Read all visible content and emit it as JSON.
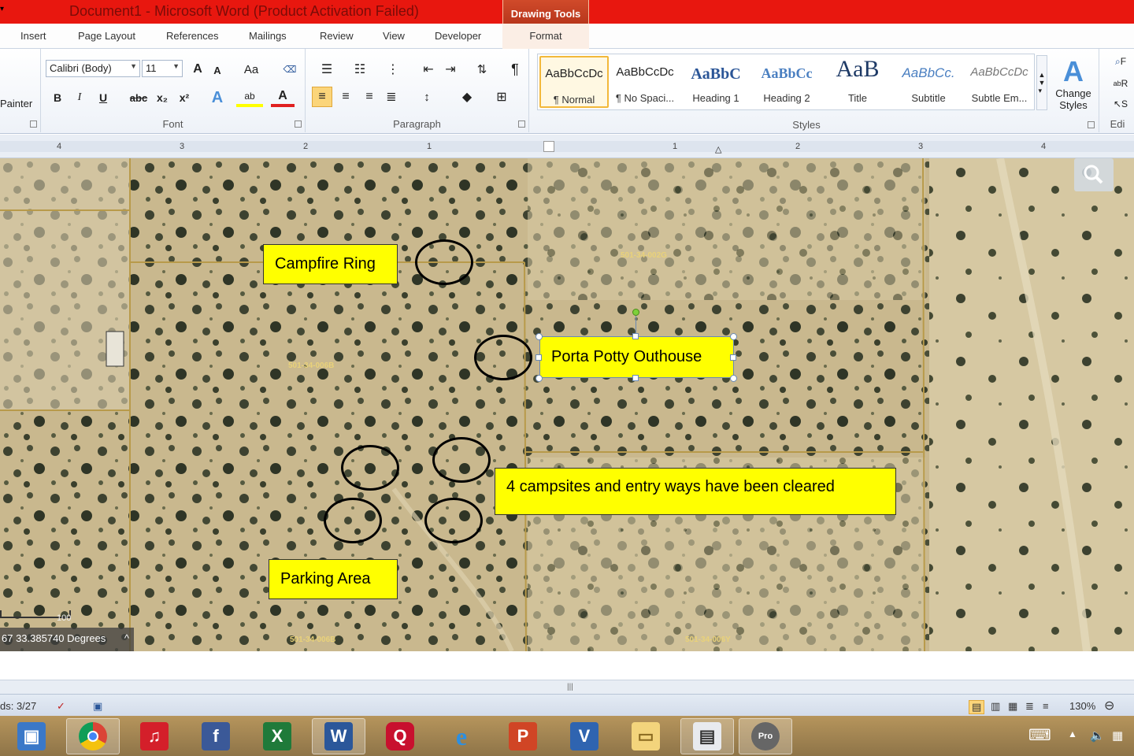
{
  "window": {
    "title": "Document1  -  Microsoft Word (Product Activation Failed)",
    "context_tab_group": "Drawing Tools"
  },
  "tabs": [
    "Insert",
    "Page Layout",
    "References",
    "Mailings",
    "Review",
    "View",
    "Developer",
    "Format"
  ],
  "ribbon": {
    "clipboard": {
      "painter_label": "Painter"
    },
    "font": {
      "label": "Font",
      "font_name": "Calibri (Body)",
      "font_size": "11",
      "grow": "A",
      "shrink": "A",
      "change_case": "Aa",
      "bold": "B",
      "italic": "I",
      "underline": "U",
      "strike": "abc",
      "subscript": "x₂",
      "superscript": "x²",
      "highlight": "ab",
      "font_color": "A"
    },
    "paragraph": {
      "label": "Paragraph",
      "pilcrow": "¶"
    },
    "styles": {
      "label": "Styles",
      "items": [
        {
          "sample": "AaBbCcDc",
          "name": "¶ Normal"
        },
        {
          "sample": "AaBbCcDc",
          "name": "¶ No Spaci..."
        },
        {
          "sample": "AaBbC",
          "name": "Heading 1"
        },
        {
          "sample": "AaBbCc",
          "name": "Heading 2"
        },
        {
          "sample": "AaB",
          "name": "Title"
        },
        {
          "sample": "AaBbCc.",
          "name": "Subtitle"
        },
        {
          "sample": "AaBbCcDc",
          "name": "Subtle Em..."
        }
      ],
      "change_styles": "Change Styles"
    },
    "editing": {
      "label": "Edi",
      "find": "F",
      "replace": "R",
      "select": "S"
    }
  },
  "ruler": {
    "ticks": [
      "4",
      "3",
      "2",
      "1",
      "1",
      "2",
      "3",
      "4"
    ]
  },
  "document": {
    "labels": {
      "campfire": "Campfire Ring",
      "porta": "Porta Potty Outhouse",
      "campsites": "4 campsites  and entry ways have been cleared",
      "parking": "Parking Area"
    },
    "parcels": [
      "501-34-002G",
      "501-34-006B",
      "501-34-006B",
      "501-34-006Y"
    ],
    "scale_label": "100",
    "coordinate_readout": "67 33.385740 Degrees"
  },
  "status": {
    "words": "ds: 3/27",
    "zoom": "130%"
  },
  "colors": {
    "titlebar": "#e8170f",
    "highlight_box": "#ffff00",
    "accent_ribbon": "#2b579a"
  },
  "taskbar": {
    "icons": [
      "control-panel-icon",
      "chrome-icon",
      "music-icon",
      "facebook-icon",
      "excel-icon",
      "word-icon",
      "quicken-icon",
      "internet-explorer-icon",
      "powerpoint-icon",
      "visio-icon",
      "file-explorer-icon",
      "scanner-icon",
      "google-earth-pro-icon"
    ]
  }
}
